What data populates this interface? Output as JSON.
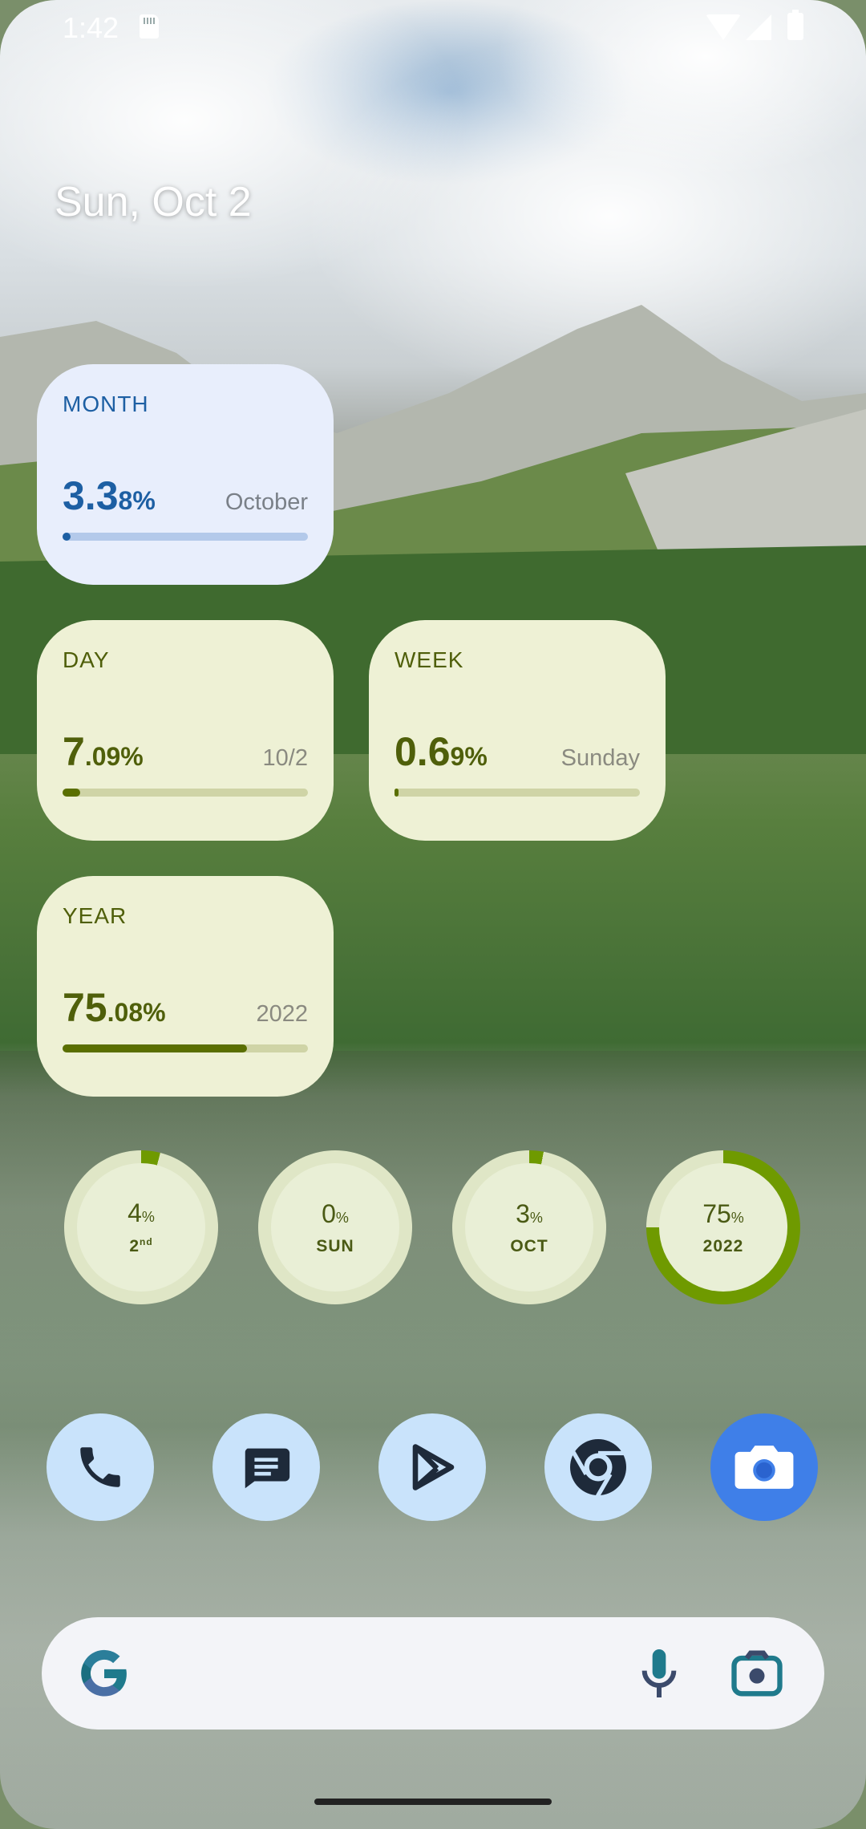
{
  "status_bar": {
    "time": "1:42"
  },
  "date": "Sun, Oct 2",
  "cards": {
    "month": {
      "label": "MONTH",
      "value_main": "3.3",
      "value_small": "8%",
      "sub": "October",
      "progress": 0.0338
    },
    "day": {
      "label": "DAY",
      "value_main": "7",
      "value_small": ".09%",
      "sub": "10/2",
      "progress": 0.0709
    },
    "week": {
      "label": "WEEK",
      "value_main": "0.6",
      "value_small": "9%",
      "sub": "Sunday",
      "progress": 0.0069
    },
    "year": {
      "label": "YEAR",
      "value_main": "75",
      "value_small": ".08%",
      "sub": "2022",
      "progress": 0.7508
    }
  },
  "rings": [
    {
      "value": "4",
      "unit": "%",
      "caption": "2",
      "caption_sup": "nd",
      "progress": 0.04
    },
    {
      "value": "0",
      "unit": "%",
      "caption": "SUN",
      "caption_sup": "",
      "progress": 0.0
    },
    {
      "value": "3",
      "unit": "%",
      "caption": "OCT",
      "caption_sup": "",
      "progress": 0.03
    },
    {
      "value": "75",
      "unit": "%",
      "caption": "2022",
      "caption_sup": "",
      "progress": 0.75
    }
  ],
  "dock": [
    "phone-icon",
    "messages-icon",
    "play-store-icon",
    "chrome-icon",
    "camera-icon"
  ],
  "colors": {
    "ring_track": "#dfe6c6",
    "ring_fill": "#6f9a00",
    "month_accent": "#1d5fa3",
    "green_accent": "#4f5f0a"
  }
}
